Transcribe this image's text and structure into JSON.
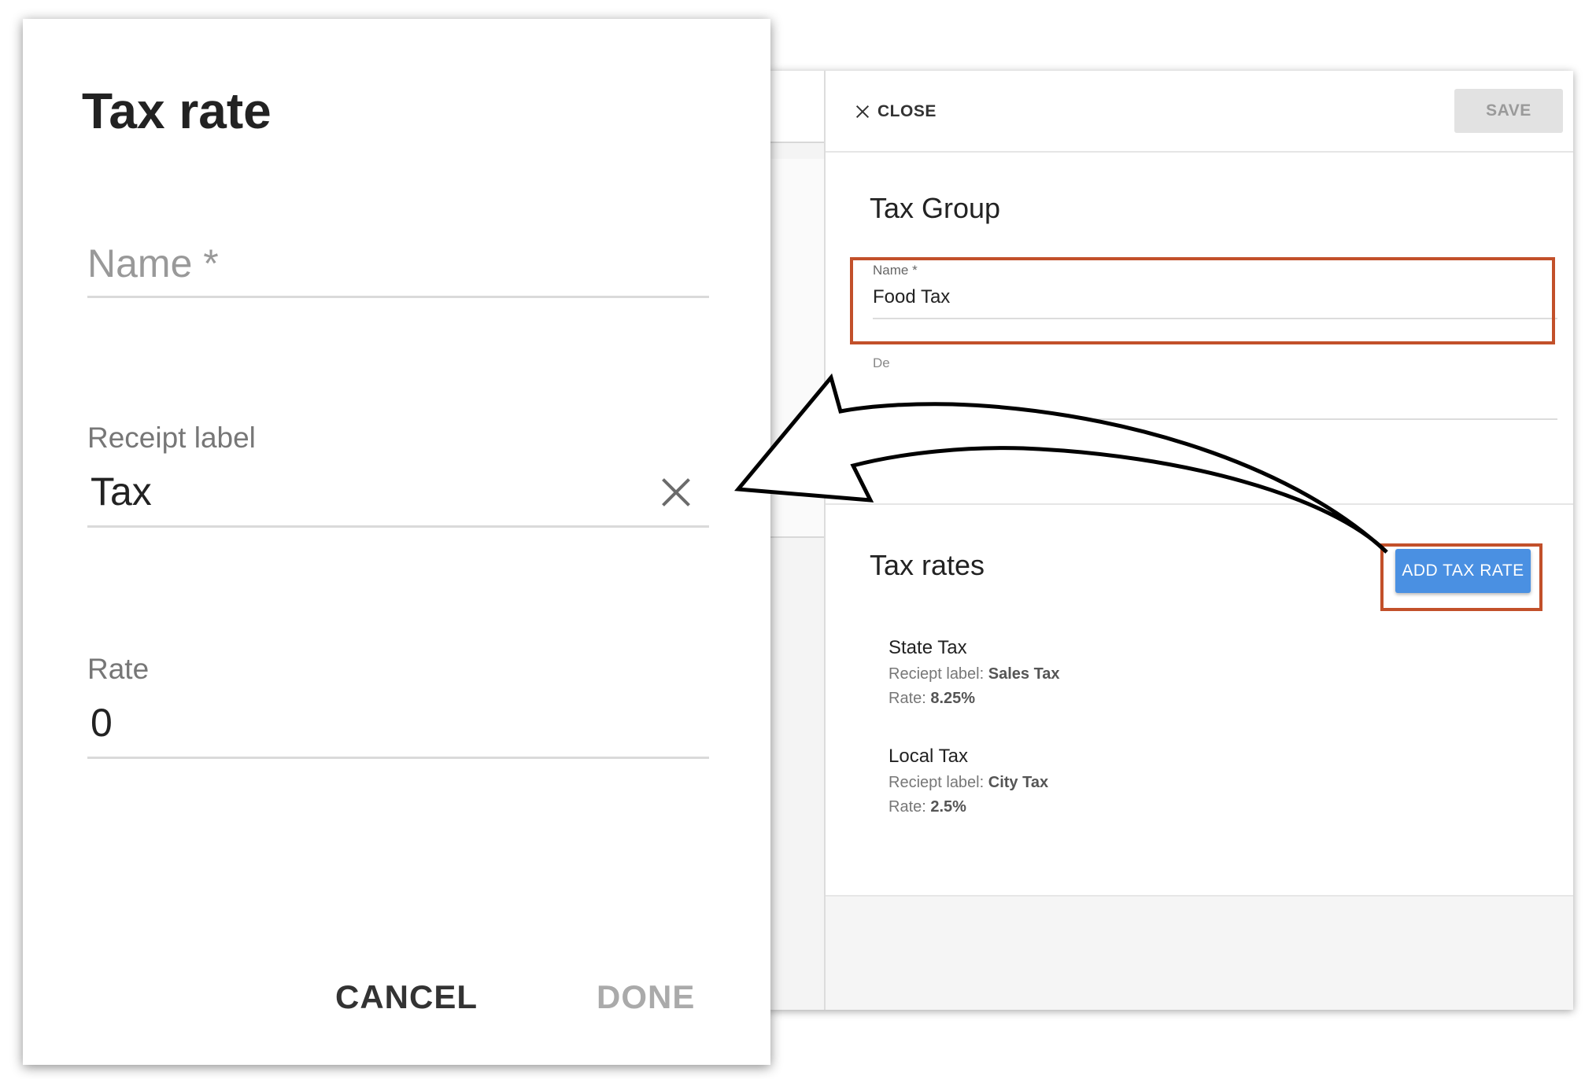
{
  "tax_group_panel": {
    "close_label": "CLOSE",
    "save_label": "SAVE",
    "title": "Tax Group",
    "name_field": {
      "label": "Name *",
      "value": "Food Tax"
    },
    "description_field": {
      "label": "De"
    },
    "rates_title": "Tax rates",
    "add_rate_label": "ADD TAX RATE",
    "rates": [
      {
        "name": "State Tax",
        "receipt_prefix": "Reciept label: ",
        "receipt_value": "Sales Tax",
        "rate_prefix": "Rate: ",
        "rate_value": "8.25%"
      },
      {
        "name": "Local Tax",
        "receipt_prefix": "Reciept label: ",
        "receipt_value": "City Tax",
        "rate_prefix": "Rate: ",
        "rate_value": "2.5%"
      }
    ]
  },
  "tax_rate_dialog": {
    "title": "Tax rate",
    "name_placeholder": "Name *",
    "receipt_label": "Receipt label",
    "receipt_value": "Tax",
    "rate_label": "Rate",
    "rate_value": "0",
    "cancel_label": "CANCEL",
    "done_label": "DONE"
  },
  "colors": {
    "highlight": "#c2502a",
    "primary_button": "#4a90e2"
  },
  "icons": [
    "close-icon",
    "clear-icon"
  ]
}
